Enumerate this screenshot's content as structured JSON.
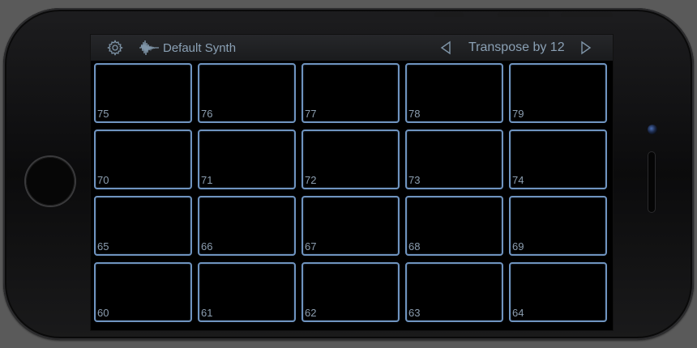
{
  "header": {
    "settings_icon": "gear-icon",
    "waveform_icon": "waveform-icon",
    "instrument_name": "Default Synth",
    "prev_icon": "triangle-left-icon",
    "transpose_label": "Transpose by 12",
    "next_icon": "triangle-right-icon"
  },
  "pads": [
    [
      "75",
      "76",
      "77",
      "78",
      "79"
    ],
    [
      "70",
      "71",
      "72",
      "73",
      "74"
    ],
    [
      "65",
      "66",
      "67",
      "68",
      "69"
    ],
    [
      "60",
      "61",
      "62",
      "63",
      "64"
    ]
  ],
  "colors": {
    "pad_border": "#6f94c0",
    "text": "#8aa0b4",
    "screen_bg": "#000000"
  }
}
